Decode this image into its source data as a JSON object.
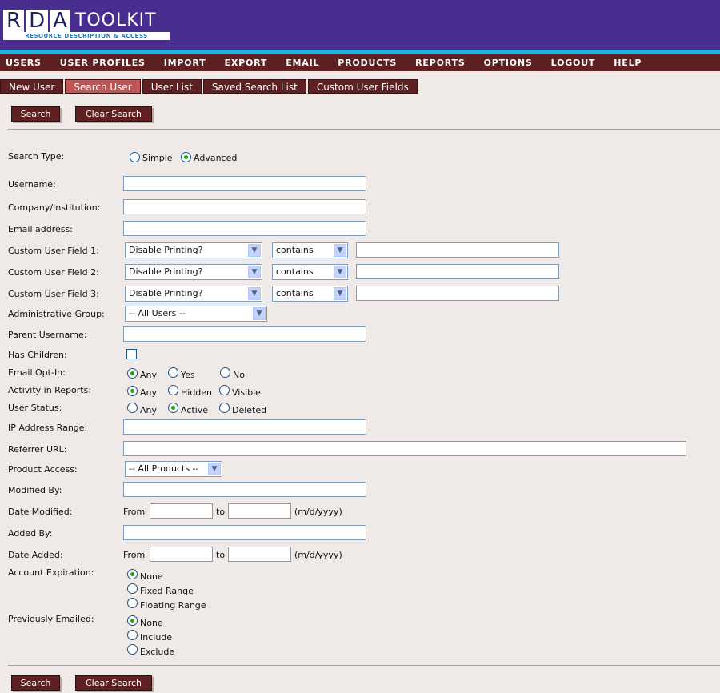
{
  "logo": {
    "letters": [
      "R",
      "D",
      "A"
    ],
    "word": "TOOLKIT",
    "subtitle": "RESOURCE DESCRIPTION & ACCESS"
  },
  "nav": [
    "USERS",
    "USER PROFILES",
    "IMPORT",
    "EXPORT",
    "EMAIL",
    "PRODUCTS",
    "REPORTS",
    "OPTIONS",
    "LOGOUT",
    "HELP"
  ],
  "tabs": [
    {
      "label": "New User",
      "active": false
    },
    {
      "label": "Search User",
      "active": true
    },
    {
      "label": "User List",
      "active": false
    },
    {
      "label": "Saved Search List",
      "active": false
    },
    {
      "label": "Custom User Fields",
      "active": false
    }
  ],
  "buttons": {
    "search": "Search",
    "clear": "Clear Search"
  },
  "form": {
    "search_type": {
      "label": "Search Type:",
      "options": [
        "Simple",
        "Advanced"
      ],
      "selected": "Advanced"
    },
    "username": {
      "label": "Username:",
      "value": ""
    },
    "company": {
      "label": "Company/Institution:",
      "value": ""
    },
    "email": {
      "label": "Email address:",
      "value": ""
    },
    "custom1": {
      "label": "Custom User Field 1:",
      "field": "Disable Printing?",
      "operator": "contains",
      "value": ""
    },
    "custom2": {
      "label": "Custom User Field 2:",
      "field": "Disable Printing?",
      "operator": "contains",
      "value": ""
    },
    "custom3": {
      "label": "Custom User Field 3:",
      "field": "Disable Printing?",
      "operator": "contains",
      "value": ""
    },
    "admin_group": {
      "label": "Administrative Group:",
      "value": "-- All Users --"
    },
    "parent_username": {
      "label": "Parent Username:",
      "value": ""
    },
    "has_children": {
      "label": "Has Children:",
      "checked": false
    },
    "email_optin": {
      "label": "Email Opt-In:",
      "options": [
        "Any",
        "Yes",
        "No"
      ],
      "selected": "Any"
    },
    "activity": {
      "label": "Activity in Reports:",
      "options": [
        "Any",
        "Hidden",
        "Visible"
      ],
      "selected": "Any"
    },
    "user_status": {
      "label": "User Status:",
      "options": [
        "Any",
        "Active",
        "Deleted"
      ],
      "selected": "Active"
    },
    "ip_range": {
      "label": "IP Address Range:",
      "value": ""
    },
    "referrer": {
      "label": "Referrer URL:",
      "value": ""
    },
    "product_access": {
      "label": "Product Access:",
      "value": "-- All Products --"
    },
    "modified_by": {
      "label": "Modified By:",
      "value": ""
    },
    "date_modified": {
      "label": "Date Modified:",
      "from": "From",
      "to": "to",
      "format": "(m/d/yyyy)"
    },
    "added_by": {
      "label": "Added By:",
      "value": ""
    },
    "date_added": {
      "label": "Date Added:",
      "from": "From",
      "to": "to",
      "format": "(m/d/yyyy)"
    },
    "account_expiration": {
      "label": "Account Expiration:",
      "options": [
        "None",
        "Fixed Range",
        "Floating Range"
      ],
      "selected": "None"
    },
    "previously_emailed": {
      "label": "Previously Emailed:",
      "options": [
        "None",
        "Include",
        "Exclude"
      ],
      "selected": "None"
    }
  },
  "colors": {
    "header": "#4a2e8f",
    "accent": "#23b3dc",
    "nav": "#5e2020",
    "active_tab": "#c05555",
    "background": "#efe9e8"
  }
}
